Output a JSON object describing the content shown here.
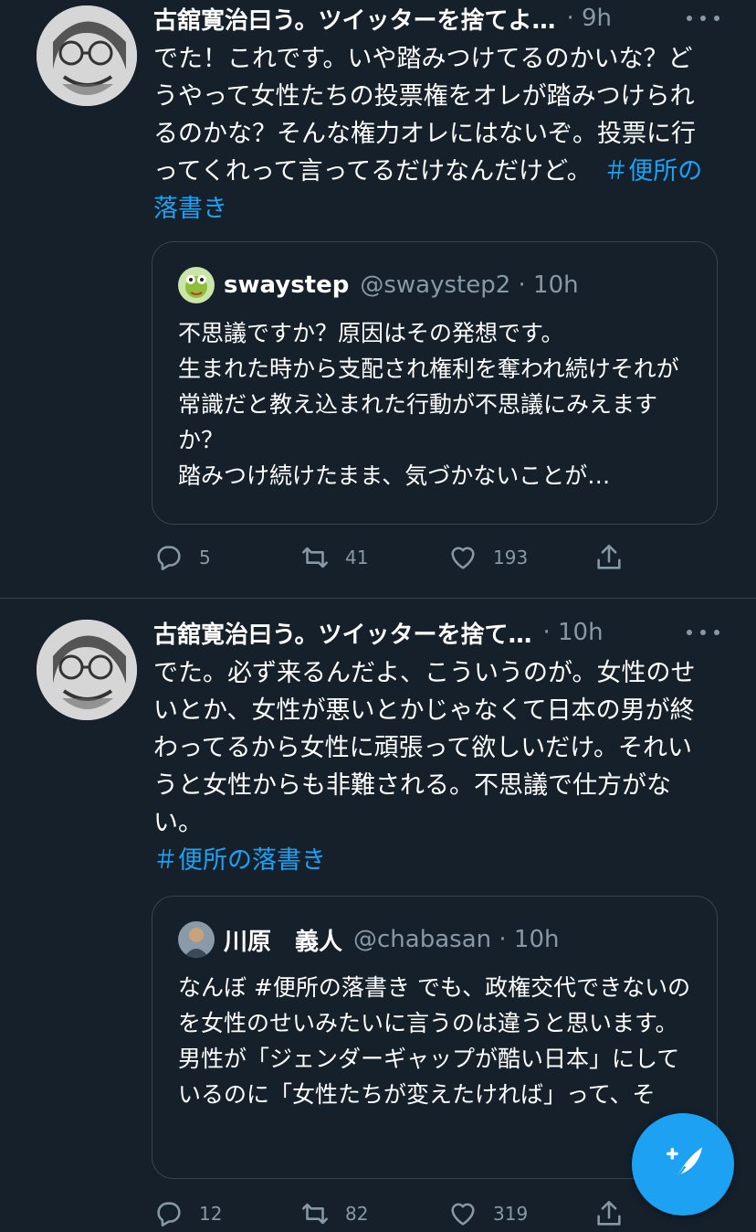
{
  "colors": {
    "background": "#15202b",
    "border": "#38444d",
    "secondary_text": "#8899a6",
    "accent": "#1da1f2"
  },
  "tweets": [
    {
      "author_name": "古舘寛治曰う。ツイッターを捨てよ…",
      "time": "· 9h",
      "text_parts": [
        "でた！これです。いや踏みつけてるのかいな？どうやって女性たちの投票権をオレが踏みつけられるのかな？そんな権力オレにはないぞ。投票に行ってくれって言ってるだけなんだけど。",
        "＃便所の落書き"
      ],
      "quote": {
        "name": "swaystep",
        "handle": "@swaystep2 · 10h",
        "text": "不思議ですか？原因はその発想です。\n生まれた時から支配され権利を奪われ続けそれが常識だと教え込まれた行動が不思議にみえますか？\n踏みつけ続けたまま、気づかないことが…"
      },
      "actions": {
        "replies": "5",
        "retweets": "41",
        "likes": "193"
      }
    },
    {
      "author_name": "古舘寛治曰う。ツイッターを捨て…",
      "time": "· 10h",
      "text_parts": [
        "でた。必ず来るんだよ、こういうのが。女性のせいとか、女性が悪いとかじゃなくて日本の男が終わってるから女性に頑張って欲しいだけ。それいうと女性からも非難される。不思議で仕方がない。",
        "＃便所の落書き"
      ],
      "quote": {
        "name": "川原　義人",
        "handle": "@chabasan · 10h",
        "text": "なんぼ #便所の落書き でも、政権交代できないのを女性のせいみたいに言うのは違うと思います。男性が「ジェンダーギャップが酷い日本」にしているのに「女性たちが変えたければ」って、そ"
      },
      "actions": {
        "replies": "12",
        "retweets": "82",
        "likes": "319"
      }
    }
  ],
  "icons": {
    "reply": "reply-icon",
    "retweet": "retweet-icon",
    "like": "heart-icon",
    "share": "share-icon",
    "more": "more-icon",
    "compose": "compose-tweet-icon"
  }
}
